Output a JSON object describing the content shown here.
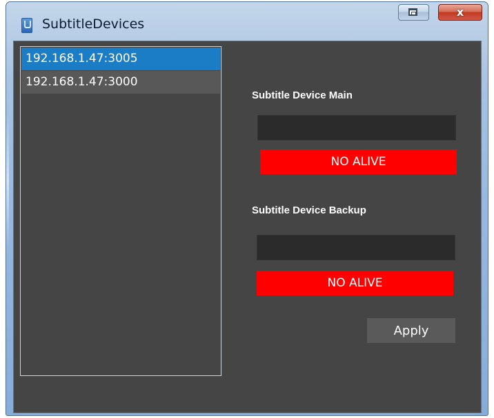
{
  "window": {
    "title": "SubtitleDevices",
    "close_label": "x",
    "icons": {
      "app": "app-icon",
      "restore": "restore-icon",
      "close": "close-icon"
    }
  },
  "device_list": {
    "items": [
      {
        "label": "192.168.1.47:3005",
        "selected": true
      },
      {
        "label": "192.168.1.47:3000",
        "selected": false
      }
    ]
  },
  "main_device": {
    "label": "Subtitle Device Main",
    "value": "",
    "status": "NO ALIVE"
  },
  "backup_device": {
    "label": "Subtitle Device Backup",
    "value": "",
    "status": "NO ALIVE"
  },
  "apply_label": "Apply",
  "colors": {
    "background": "#454545",
    "selected_item": "#1c7dc7",
    "status_bad": "#ff0000",
    "field": "#2b2b2b",
    "button": "#5a5a5a"
  }
}
